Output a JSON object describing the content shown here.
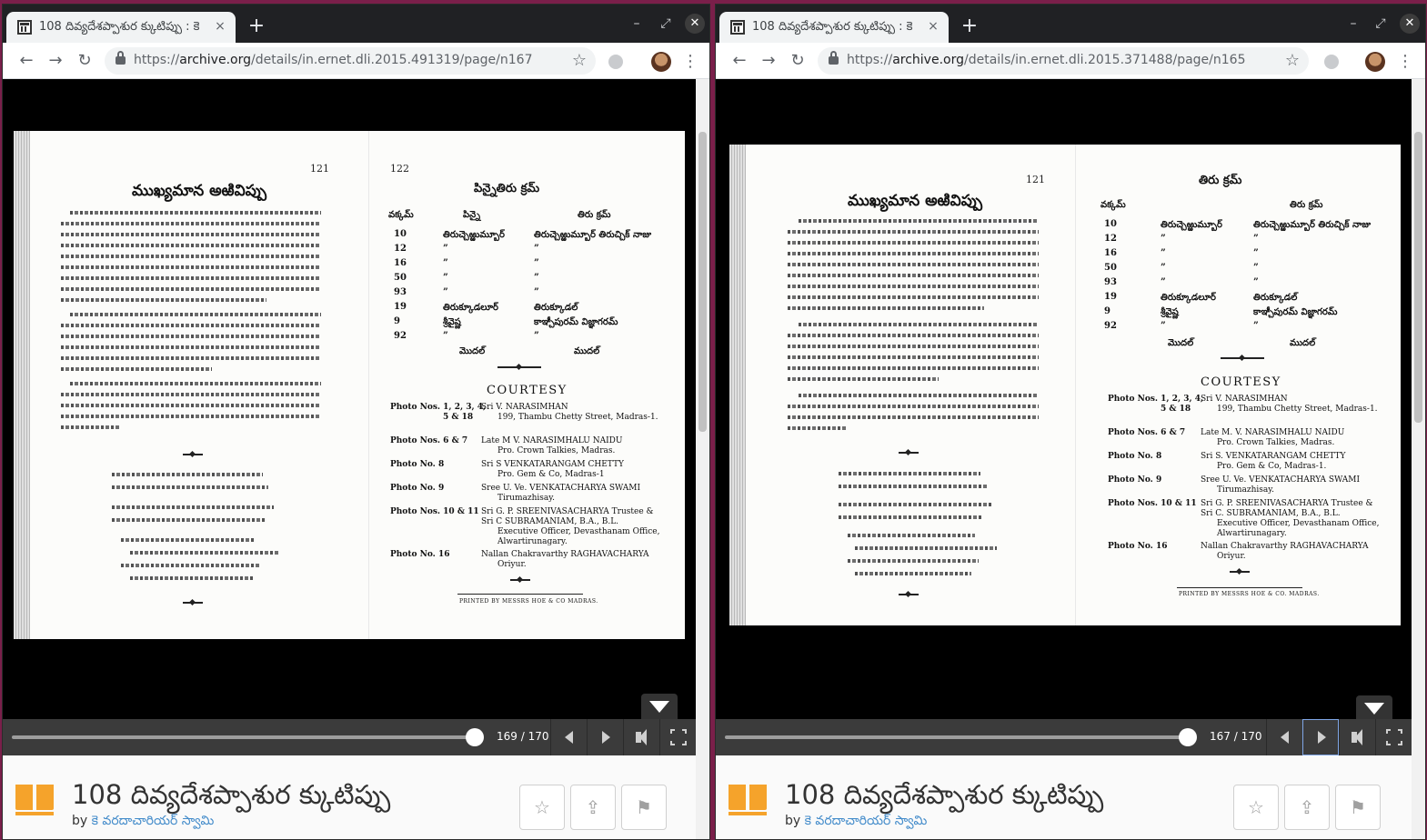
{
  "left": {
    "tab": {
      "title": "108 దివ్యదేశప్పాశుర క్కుటిప్పు : కె",
      "close": "×"
    },
    "new_tab": "+",
    "window_controls": {
      "minimize": "–",
      "maximize": "⤢",
      "close": "✕"
    },
    "nav": {
      "back": "←",
      "forward": "→",
      "reload": "↻"
    },
    "url": {
      "scheme": "https://",
      "host": "archive.org",
      "path": "/details/in.ernet.dli.2015.491319/page/n167"
    },
    "star": "☆",
    "menu": "⋮",
    "book": {
      "page_numbers": {
        "left": "121",
        "right": "122"
      },
      "left_title": "ముఖ్యమాన అఱివిప్పు",
      "right_title": "పిన్నైతిరు క్రమ్",
      "table_head": {
        "c1": "వక్కమ్",
        "c2": "పిన్నై",
        "c3": "తిరు క్రమ్"
      },
      "table_rows": [
        {
          "num": "10",
          "a": "తిరుచ్చెఱ్ఱుమ్బూర్",
          "b": "తిరుచ్చెఱ్ఱుమ్బూర్ తిరుచ్చిక్ నాజు"
        },
        {
          "num": "12",
          "a": "”",
          "b": "”"
        },
        {
          "num": "16",
          "a": "”",
          "b": "”"
        },
        {
          "num": "50",
          "a": "”",
          "b": "”"
        },
        {
          "num": "93",
          "a": "”",
          "b": "”"
        },
        {
          "num": "19",
          "a": "తిరుక్కూడలూర్",
          "b": "తిరుక్కూడల్"
        },
        {
          "num": "9",
          "a": "శ్రీవైష్ణ",
          "b": "కాఞ్చీపురమ్ విజ్ఞాగరమ్"
        },
        {
          "num": "92",
          "a": "”",
          "b": "”"
        }
      ],
      "table_foot": {
        "a": "మొదల్",
        "b": "ముదల్"
      },
      "courtesy": "COURTESY",
      "credits": [
        {
          "label": "Photo Nos. 1, 2, 3, 4,",
          "label2": "5 & 18",
          "lines": [
            "Sri V. NARASIMHAN",
            "199, Thambu Chetty Street, Madras-1."
          ]
        },
        {
          "label": "Photo Nos. 6 & 7",
          "lines": [
            "Late M V. NARASIMHALU NAIDU",
            "Pro. Crown Talkies, Madras."
          ]
        },
        {
          "label": "Photo No. 8",
          "lines": [
            "Sri S VENKATARANGAM CHETTY",
            "Pro. Gem & Co, Madras-1"
          ]
        },
        {
          "label": "Photo No. 9",
          "lines": [
            "Sree U. Ve. VENKATACHARYA SWAMI",
            "Tirumazhisay."
          ]
        },
        {
          "label": "Photo Nos. 10 & 11",
          "lines": [
            "Sri G. P. SREENIVASACHARYA Trustee &",
            "Sri C SUBRAMANIAM, B.A., B.L.",
            "Executive Officer, Devasthanam Office,",
            "Alwartirunagary."
          ]
        },
        {
          "label": "Photo No. 16",
          "lines": [
            "Nallan Chakravarthy RAGHAVACHARYA",
            "Oriyur."
          ]
        }
      ],
      "printed": "PRINTED BY MESSRS HOE & CO MADRAS."
    },
    "reader": {
      "page_count": "169 / 170",
      "progress": 0.99
    },
    "item": {
      "title": "108 దివ్యదేశప్పాశుర క్కుటిప్పు",
      "by": "by",
      "author": "కె వరదాచారియర్ స్వామి"
    }
  },
  "right": {
    "tab": {
      "title": "108 దివ్యదేశప్పాశుర క్కుటిప్పు : కె",
      "close": "×"
    },
    "new_tab": "+",
    "window_controls": {
      "minimize": "–",
      "maximize": "⤢",
      "close": "✕"
    },
    "nav": {
      "back": "←",
      "forward": "→",
      "reload": "↻"
    },
    "url": {
      "scheme": "https://",
      "host": "archive.org",
      "path": "/details/in.ernet.dli.2015.371488/page/n165"
    },
    "star": "☆",
    "menu": "⋮",
    "book": {
      "page_numbers": {
        "left": "121"
      },
      "left_title": "ముఖ్యమాన అఱివిప్పు",
      "right_title": "తిరు క్రమ్",
      "table_head": {
        "c1": "వక్కమ్",
        "c3": "తిరు క్రమ్"
      },
      "table_rows": [
        {
          "num": "10",
          "a": "తిరుచ్చెఱ్ఱుమ్బూర్",
          "b": "తిరుచ్చెఱ్ఱుమ్బూర్ తిరుచ్చిక్ నాజు"
        },
        {
          "num": "12",
          "a": "”",
          "b": "”"
        },
        {
          "num": "16",
          "a": "”",
          "b": "”"
        },
        {
          "num": "50",
          "a": "”",
          "b": "”"
        },
        {
          "num": "93",
          "a": "”",
          "b": "”"
        },
        {
          "num": "19",
          "a": "తిరుక్కూడలూర్",
          "b": "తిరుక్కూడల్"
        },
        {
          "num": "9",
          "a": "శ్రీవైష్ణ",
          "b": "కాఞ్చీపురమ్ విజ్ఞాగరమ్"
        },
        {
          "num": "92",
          "a": "”",
          "b": "”"
        }
      ],
      "table_foot": {
        "a": "మొదల్",
        "b": "ముదల్"
      },
      "courtesy": "COURTESY",
      "credits": [
        {
          "label": "Photo Nos. 1, 2, 3, 4,",
          "label2": "5 & 18",
          "lines": [
            "Sri V. NARASIMHAN",
            "199, Thambu Chetty Street, Madras-1."
          ]
        },
        {
          "label": "Photo Nos. 6 & 7",
          "lines": [
            "Late M. V. NARASIMHALU NAIDU",
            "Pro. Crown Talkies, Madras."
          ]
        },
        {
          "label": "Photo No. 8",
          "lines": [
            "Sri S. VENKATARANGAM CHETTY",
            "Pro. Gem & Co, Madras-1."
          ]
        },
        {
          "label": "Photo No. 9",
          "lines": [
            "Sree U. Ve. VENKATACHARYA SWAMI",
            "Tirumazhisay."
          ]
        },
        {
          "label": "Photo Nos. 10 & 11",
          "lines": [
            "Sri G. P. SREENIVASACHARYA Trustee &",
            "Sri C. SUBRAMANIAM, B.A., B.L.",
            "Executive Officer, Devasthanam Office,",
            "Alwartirunagary."
          ]
        },
        {
          "label": "Photo No. 16",
          "lines": [
            "Nallan Chakravarthy RAGHAVACHARYA",
            "Oriyur."
          ]
        }
      ],
      "printed": "PRINTED BY MESSRS HOE & CO. MADRAS."
    },
    "reader": {
      "page_count": "167 / 170",
      "progress": 0.99
    },
    "item": {
      "title": "108 దివ్యదేశప్పాశుర క్కుటిప్పు",
      "by": "by",
      "author": "కె వరదాచారియర్ స్వామి"
    }
  },
  "glyphs": {
    "share": "⇪",
    "flag": "⚑",
    "fav": "☆",
    "quote": "”"
  }
}
